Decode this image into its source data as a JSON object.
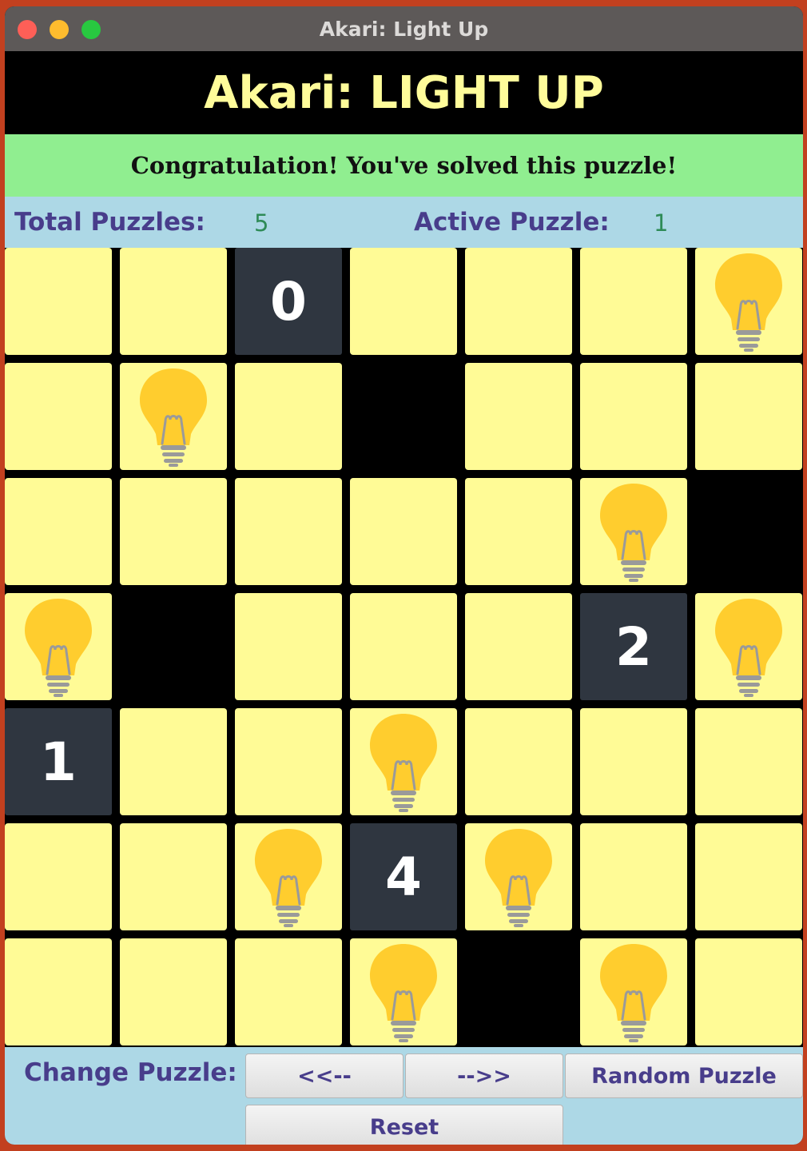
{
  "window": {
    "title": "Akari: Light Up"
  },
  "header": {
    "title": "Akari: LIGHT UP"
  },
  "message": "Congratulation! You've solved this puzzle!",
  "info": {
    "total_label": "Total Puzzles:",
    "total_value": "5",
    "active_label": "Active Puzzle:",
    "active_value": "1"
  },
  "board": {
    "rows": 7,
    "cols": 7,
    "cells": [
      [
        "lit",
        "lit",
        "0",
        "lit",
        "lit",
        "lit",
        "bulb"
      ],
      [
        "lit",
        "bulb",
        "lit",
        "wall",
        "lit",
        "lit",
        "lit"
      ],
      [
        "lit",
        "lit",
        "lit",
        "lit",
        "lit",
        "bulb",
        "wall"
      ],
      [
        "bulb",
        "wall",
        "lit",
        "lit",
        "lit",
        "2",
        "bulb"
      ],
      [
        "1",
        "lit",
        "lit",
        "bulb",
        "lit",
        "lit",
        "lit"
      ],
      [
        "lit",
        "lit",
        "bulb",
        "4",
        "bulb",
        "lit",
        "lit"
      ],
      [
        "lit",
        "lit",
        "lit",
        "bulb",
        "wall",
        "bulb",
        "lit"
      ]
    ]
  },
  "controls": {
    "change_label": "Change Puzzle:",
    "prev_label": "<<--",
    "next_label": "-->>",
    "random_label": "Random Puzzle",
    "reset_label": "Reset"
  },
  "colors": {
    "lit": "#fffb96",
    "clue": "#2f3640",
    "bulb": "#ffcd2e",
    "success": "#90ee90",
    "info_bg": "#add8e6",
    "label": "#483d8b",
    "value": "#2e8b57"
  },
  "icons": {
    "bulb": "lightbulb-icon"
  }
}
